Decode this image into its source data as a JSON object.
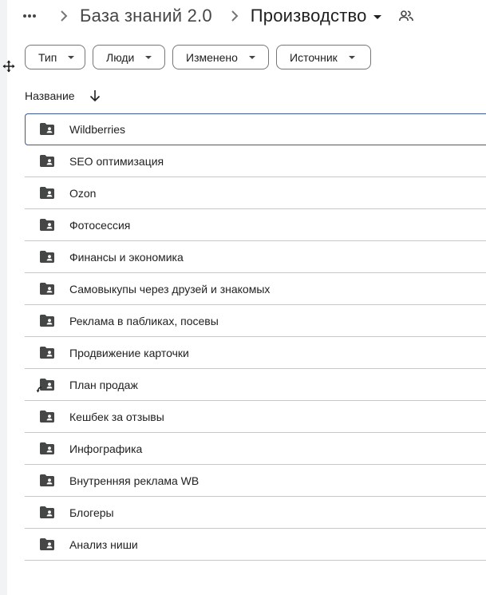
{
  "breadcrumb": {
    "more_icon": "more-horiz-icon",
    "separator_icon": "chevron-right-icon",
    "parent": "База знаний 2.0",
    "current": "Производство",
    "share_icon": "people-icon"
  },
  "filters": [
    {
      "label": "Тип"
    },
    {
      "label": "Люди"
    },
    {
      "label": "Изменено"
    },
    {
      "label": "Источник"
    }
  ],
  "list_header": {
    "name_label": "Название",
    "sort_icon": "arrow-down-icon"
  },
  "rows": [
    {
      "name": "Wildberries",
      "icon": "shared-folder-icon",
      "selected": true
    },
    {
      "name": "SEO оптимизация",
      "icon": "shared-folder-icon"
    },
    {
      "name": "Ozon",
      "icon": "shared-folder-icon"
    },
    {
      "name": "Фотосессия",
      "icon": "shared-folder-icon"
    },
    {
      "name": "Финансы и экономика",
      "icon": "shared-folder-icon"
    },
    {
      "name": "Самовыкупы через друзей и знакомых",
      "icon": "shared-folder-icon"
    },
    {
      "name": "Реклама в пабликах, посевы",
      "icon": "shared-folder-icon"
    },
    {
      "name": "Продвижение карточки",
      "icon": "shared-folder-icon"
    },
    {
      "name": "План продаж",
      "icon": "shared-folder-shortcut-icon"
    },
    {
      "name": "Кешбек за отзывы",
      "icon": "shared-folder-icon"
    },
    {
      "name": "Инфографика",
      "icon": "shared-folder-icon"
    },
    {
      "name": "Внутренняя реклама WB",
      "icon": "shared-folder-icon"
    },
    {
      "name": "Блогеры",
      "icon": "shared-folder-icon"
    },
    {
      "name": "Анализ ниши",
      "icon": "shared-folder-icon"
    }
  ],
  "colors": {
    "folder": "#444746",
    "divider": "#c7c7c7",
    "selected_border": "#3c5a99"
  }
}
